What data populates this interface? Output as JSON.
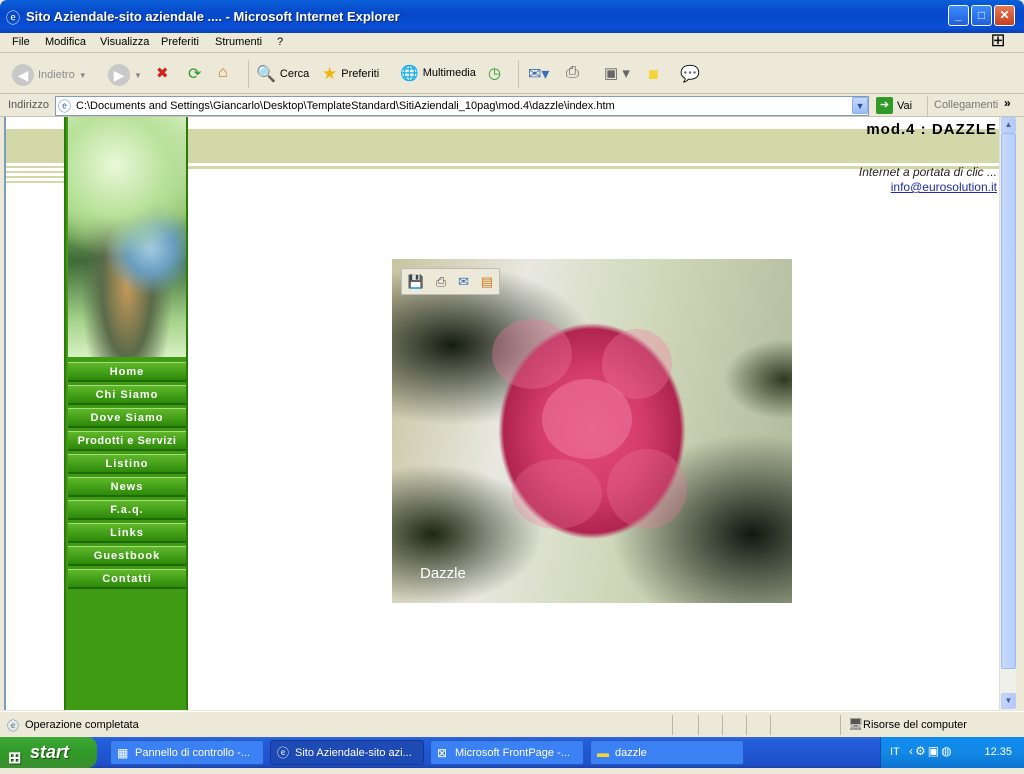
{
  "window": {
    "title": "Sito Aziendale-sito aziendale .... - Microsoft Internet Explorer",
    "minimize": "_",
    "maximize": "□",
    "close": "✕"
  },
  "menu": [
    "File",
    "Modifica",
    "Visualizza",
    "Preferiti",
    "Strumenti",
    "?"
  ],
  "toolbar": {
    "back": "Indietro",
    "search": "Cerca",
    "favorites": "Preferiti",
    "media": "Multimedia"
  },
  "address": {
    "label": "Indirizzo",
    "url": "C:\\Documents and Settings\\Giancarlo\\Desktop\\TemplateStandard\\SitiAziendali_10pag\\mod.4\\dazzle\\index.htm",
    "go": "Vai",
    "links": "Collegamenti"
  },
  "site": {
    "title": "mod.4  :  DAZZLE",
    "tagline": "Internet a portata di clic ...",
    "email": "info@eurosolution.it",
    "nav": [
      "Home",
      "Chi Siamo",
      "Dove Siamo",
      "Prodotti e Servizi",
      "Listino",
      "News",
      "F.a.q.",
      "Links",
      "Guestbook",
      "Contatti"
    ],
    "image_caption": "Dazzle"
  },
  "status": {
    "text": "Operazione completata",
    "zone": "Risorse del computer"
  },
  "taskbar": {
    "start": "start",
    "tasks": [
      {
        "label": "Pannello di controllo -...",
        "active": false
      },
      {
        "label": "Sito Aziendale-sito azi...",
        "active": true
      },
      {
        "label": "Microsoft FrontPage -...",
        "active": false
      },
      {
        "label": "dazzle",
        "active": false
      }
    ],
    "lang": "IT",
    "clock": "12.35"
  },
  "colors": {
    "nav_green": "#3f9a14",
    "stripe": "#d3d8a9",
    "titlebar": "#0548c9"
  }
}
